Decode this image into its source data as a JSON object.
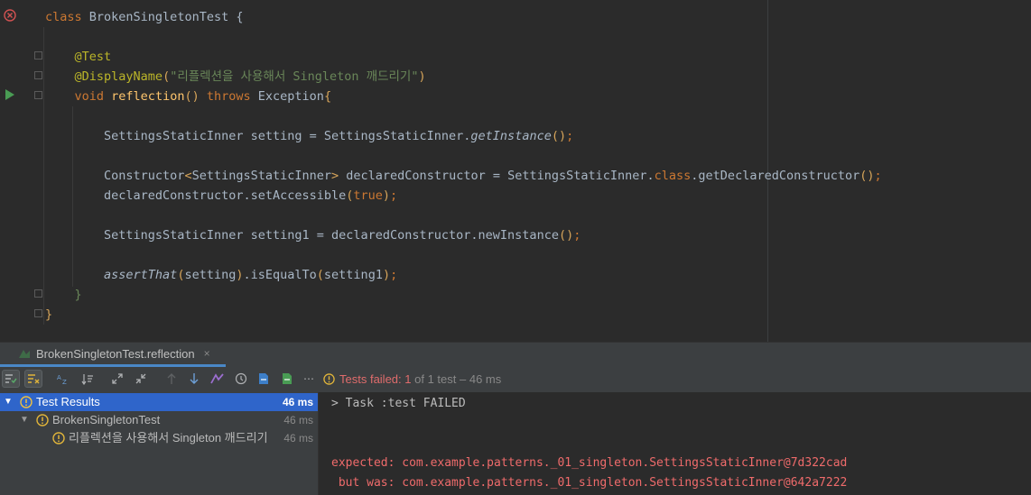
{
  "editor": {
    "lines": {
      "l1_kw": "class",
      "l1_name": "BrokenSingletonTest {",
      "l3_ann": "@Test",
      "l4_ann": "@DisplayName",
      "l4_str": "\"리플렉션을 사용해서 Singleton 깨드리기\"",
      "l5_void": "void",
      "l5_method": "reflection",
      "l5_throws": "throws",
      "l5_exc": "Exception",
      "l7_type": "SettingsStaticInner setting = SettingsStaticInner.",
      "l7_call": "getInstance",
      "l9_a": "Constructor",
      "l9_b": "SettingsStaticInner",
      "l9_c": " declaredConstructor = SettingsStaticInner.",
      "l9_class": "class",
      "l9_d": ".getDeclaredConstructor",
      "l10_a": "declaredConstructor.setAccessible",
      "l10_true": "true",
      "l12_a": "SettingsStaticInner setting1 = declaredConstructor.newInstance",
      "l14_assert": "assertThat",
      "l14_arg": "setting",
      "l14_eq": ".isEqualTo",
      "l14_arg2": "setting1",
      "close_brace": "}"
    }
  },
  "run_tab": {
    "label": "BrokenSingletonTest.reflection",
    "close": "×"
  },
  "toolbar": {
    "status_prefix": "Tests failed:",
    "status_count": "1",
    "status_suffix": "of 1 test – 46 ms"
  },
  "tree": {
    "rows": [
      {
        "label": "Test Results",
        "duration": "46 ms"
      },
      {
        "label": "BrokenSingletonTest",
        "duration": "46 ms"
      },
      {
        "label": "리플렉션을 사용해서 Singleton 깨드리기",
        "duration": "46 ms"
      }
    ]
  },
  "console": {
    "task": "> Task :test FAILED",
    "expected": "expected: com.example.patterns._01_singleton.SettingsStaticInner@7d322cad",
    "but_was": " but was: com.example.patterns._01_singleton.SettingsStaticInner@642a7222"
  },
  "colors": {
    "selection": "#2f65ca",
    "error": "#ef6b6b",
    "keyword": "#cc7832"
  }
}
